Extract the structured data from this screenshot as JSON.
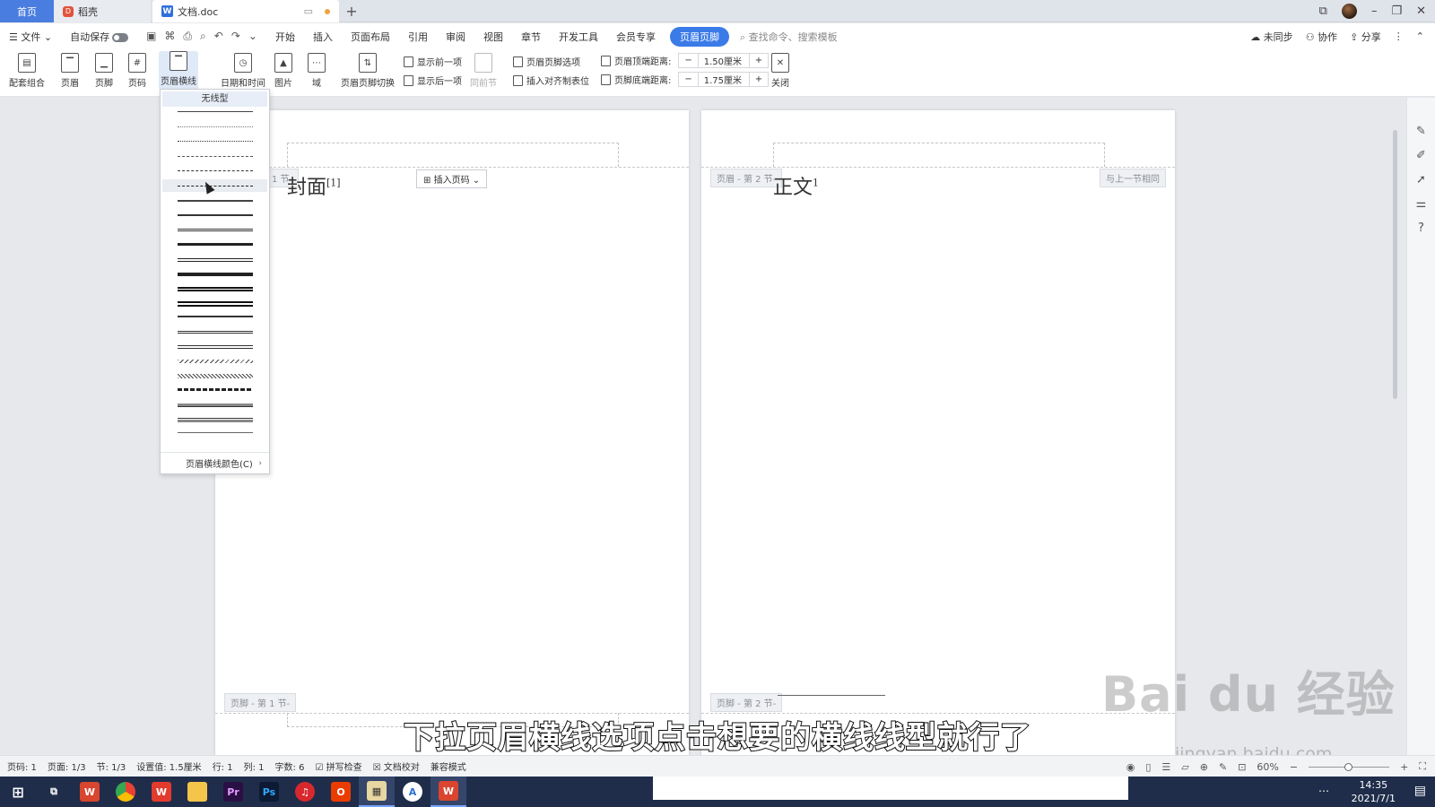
{
  "tabs": {
    "home": "首页",
    "daoke": "稻壳",
    "doc": "文档.doc",
    "add": "+"
  },
  "menubar": {
    "file": "文件",
    "autosave": "自动保存",
    "items": [
      "开始",
      "插入",
      "页面布局",
      "引用",
      "审阅",
      "视图",
      "章节",
      "开发工具",
      "会员专享"
    ],
    "active_tab": "页眉页脚",
    "search_placeholder": "查找命令、搜索模板",
    "sync": "未同步",
    "collab": "协作",
    "share": "分享"
  },
  "ribbon": {
    "combo": "配套组合",
    "header": "页眉",
    "footer": "页脚",
    "page_num": "页码",
    "header_line": "页眉横线",
    "datetime": "日期和时间",
    "picture": "图片",
    "field": "域",
    "switch": "页眉页脚切换",
    "show_prev": "显示前一项",
    "show_next": "显示后一项",
    "same_prev": "同前节",
    "options": "页眉页脚选项",
    "insert_align_tab": "插入对齐制表位",
    "header_top_label": "页眉顶端距离:",
    "header_top_value": "1.50厘米",
    "footer_bottom_label": "页脚底端距离:",
    "footer_bottom_value": "1.75厘米",
    "minus": "−",
    "plus": "+",
    "close": "关闭"
  },
  "dropdown": {
    "no_line": "无线型",
    "line_styles": [
      "thin-solid",
      "dotted-fine",
      "dotted",
      "dashed-short",
      "dash-dot",
      "dash-dot-dot",
      "solid-1",
      "solid-2",
      "double-thin",
      "solid-3",
      "thick-thin",
      "solid-4",
      "triple",
      "thick-thin-thick",
      "thin-thick",
      "double",
      "thin-thin",
      "wavy",
      "double-wavy",
      "dash-thick",
      "embossed",
      "engraved",
      "outset"
    ],
    "footer_item": "页眉横线颜色(C)"
  },
  "pages": {
    "page1_section_tag": "1 节-",
    "page1_title": "封面",
    "page1_title_sup": "[1]",
    "insert_page_num": "插入页码",
    "page1_footer_tag": "页脚 - 第 1 节-",
    "page2_header_tag": "页眉 - 第 2 节-",
    "page2_title": "正文",
    "page2_title_sup": "1",
    "page2_same_as_prev": "与上一节相同",
    "page2_footer_tag": "页脚 - 第 2 节-"
  },
  "subtitle": "下拉页眉横线选项点击想要的横线线型就行了",
  "watermark": {
    "brand": "Bai du 经验",
    "url": "jingyan.baidu.com"
  },
  "statusbar": {
    "page_num": "页码: 1",
    "pages": "页面: 1/3",
    "section": "节: 1/3",
    "setting": "设置值: 1.5厘米",
    "row": "行: 1",
    "col": "列: 1",
    "words": "字数: 6",
    "spell": "拼写检查",
    "proof": "文档校对",
    "compat": "兼容模式",
    "zoom": "60%"
  },
  "taskbar": {
    "time": "14:35",
    "date": "2021/7/1"
  }
}
